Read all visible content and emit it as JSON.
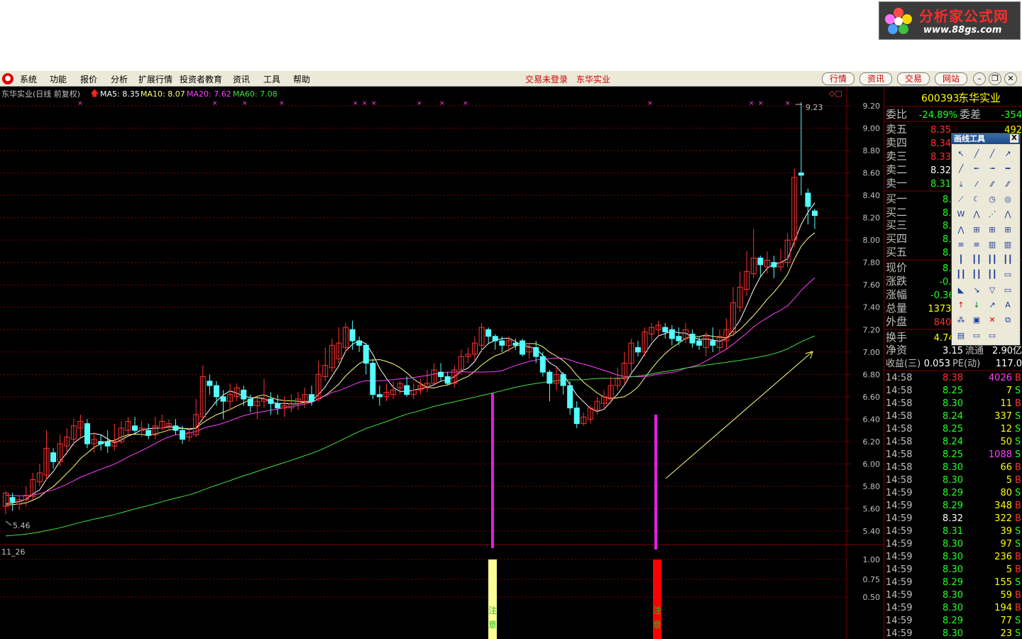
{
  "menu": {
    "items": [
      "系统",
      "功能",
      "报价",
      "分析",
      "扩展行情",
      "投资者教育",
      "资讯",
      "工具",
      "帮助"
    ],
    "center_status": "交易未登录",
    "center_stock": "东华实业",
    "tabs": [
      "行情",
      "资讯",
      "交易",
      "网站"
    ]
  },
  "logo": {
    "title": "分析家公式网",
    "url_text": "www.88gs.com"
  },
  "chart_header": {
    "stock": "东华实业(日线 前复权)",
    "ma5": "MA5: 8.35",
    "ma10": "MA10: 8.07",
    "ma20": "MA20: 7.62",
    "ma60": "MA60: 7.08"
  },
  "colors": {
    "up": "#ff3232",
    "down": "#54ffff",
    "ma5": "#ffffff",
    "ma10": "#ffff80",
    "ma20": "#ff40ff",
    "ma60": "#40e040",
    "grid": "#800000",
    "bg": "#000000"
  },
  "chart_data": {
    "type": "candlestick",
    "price_axis_ticks": [
      "9.20",
      "9.00",
      "8.80",
      "8.60",
      "8.40",
      "8.20",
      "8.00",
      "7.80",
      "7.60",
      "7.40",
      "7.20",
      "7.00",
      "6.80",
      "6.60",
      "6.40",
      "6.20",
      "6.00",
      "5.80",
      "5.60",
      "5.40"
    ],
    "ylim": [
      5.26,
      9.3
    ],
    "high_label": "9.23",
    "low_label": "5.46",
    "indicator_name": "11_26",
    "indicator_ticks": [
      "1.00",
      "0.75",
      "0.50"
    ],
    "signal_text": "注意",
    "candles": [
      [
        5.62,
        5.74,
        5.76,
        5.55
      ],
      [
        5.7,
        5.66,
        5.74,
        5.58
      ],
      [
        5.64,
        5.68,
        5.72,
        5.59
      ],
      [
        5.68,
        5.72,
        5.8,
        5.62
      ],
      [
        5.71,
        5.86,
        5.92,
        5.68
      ],
      [
        5.84,
        5.92,
        6.0,
        5.8
      ],
      [
        5.9,
        6.14,
        6.3,
        5.86
      ],
      [
        6.1,
        6.02,
        6.14,
        5.96
      ],
      [
        6.02,
        6.18,
        6.26,
        5.98
      ],
      [
        6.16,
        6.24,
        6.32,
        6.08
      ],
      [
        6.22,
        6.34,
        6.4,
        6.16
      ],
      [
        6.32,
        6.38,
        6.44,
        6.24
      ],
      [
        6.36,
        6.18,
        6.4,
        6.14
      ],
      [
        6.18,
        6.22,
        6.28,
        6.1
      ],
      [
        6.2,
        6.18,
        6.26,
        6.12
      ],
      [
        6.2,
        6.16,
        6.3,
        6.1
      ],
      [
        6.16,
        6.2,
        6.36,
        6.12
      ],
      [
        6.2,
        6.32,
        6.38,
        6.18
      ],
      [
        6.3,
        6.38,
        6.42,
        6.26
      ],
      [
        6.34,
        6.3,
        6.42,
        6.28
      ],
      [
        6.3,
        6.32,
        6.38,
        6.24
      ],
      [
        6.3,
        6.26,
        6.36,
        6.22
      ],
      [
        6.26,
        6.34,
        6.42,
        6.22
      ],
      [
        6.32,
        6.38,
        6.44,
        6.3
      ],
      [
        6.34,
        6.36,
        6.4,
        6.3
      ],
      [
        6.34,
        6.3,
        6.4,
        6.26
      ],
      [
        6.3,
        6.22,
        6.34,
        6.18
      ],
      [
        6.24,
        6.28,
        6.32,
        6.2
      ],
      [
        6.26,
        6.44,
        6.58,
        6.24
      ],
      [
        6.42,
        6.78,
        6.88,
        6.4
      ],
      [
        6.74,
        6.7,
        6.8,
        6.62
      ],
      [
        6.7,
        6.6,
        6.74,
        6.52
      ],
      [
        6.6,
        6.56,
        6.66,
        6.4
      ],
      [
        6.56,
        6.62,
        6.72,
        6.48
      ],
      [
        6.6,
        6.68,
        6.72,
        6.56
      ],
      [
        6.66,
        6.58,
        6.7,
        6.52
      ],
      [
        6.58,
        6.52,
        6.62,
        6.46
      ],
      [
        6.52,
        6.56,
        6.6,
        6.4
      ],
      [
        6.56,
        6.58,
        6.76,
        6.5
      ],
      [
        6.58,
        6.54,
        6.64,
        6.44
      ],
      [
        6.54,
        6.5,
        6.62,
        6.44
      ],
      [
        6.5,
        6.52,
        6.6,
        6.42
      ],
      [
        6.5,
        6.54,
        6.62,
        6.46
      ],
      [
        6.54,
        6.58,
        6.64,
        6.48
      ],
      [
        6.56,
        6.62,
        6.68,
        6.5
      ],
      [
        6.62,
        6.56,
        6.7,
        6.52
      ],
      [
        6.58,
        6.8,
        6.92,
        6.56
      ],
      [
        6.78,
        6.88,
        7.04,
        6.74
      ],
      [
        6.86,
        7.06,
        7.12,
        6.82
      ],
      [
        6.94,
        7.08,
        7.22,
        6.9
      ],
      [
        7.04,
        7.22,
        7.26,
        7.0
      ],
      [
        7.2,
        7.1,
        7.28,
        7.02
      ],
      [
        7.1,
        7.06,
        7.14,
        7.0
      ],
      [
        7.06,
        6.9,
        7.08,
        6.8
      ],
      [
        6.9,
        6.62,
        6.94,
        6.58
      ],
      [
        6.62,
        6.6,
        6.7,
        6.52
      ],
      [
        6.6,
        6.64,
        6.72,
        6.56
      ],
      [
        6.62,
        6.66,
        6.74,
        6.58
      ],
      [
        6.68,
        6.72,
        6.74,
        6.62
      ],
      [
        6.7,
        6.62,
        6.78,
        6.6
      ],
      [
        6.62,
        6.66,
        6.72,
        6.58
      ],
      [
        6.66,
        6.7,
        6.76,
        6.62
      ],
      [
        6.68,
        6.72,
        6.84,
        6.64
      ],
      [
        6.72,
        6.84,
        6.9,
        6.7
      ],
      [
        6.82,
        6.78,
        6.9,
        6.74
      ],
      [
        6.78,
        6.72,
        6.82,
        6.7
      ],
      [
        6.72,
        6.84,
        6.88,
        6.68
      ],
      [
        6.84,
        6.96,
        7.02,
        6.8
      ],
      [
        6.96,
        6.98,
        7.04,
        6.9
      ],
      [
        6.98,
        7.08,
        7.14,
        6.92
      ],
      [
        7.06,
        7.22,
        7.26,
        7.0
      ],
      [
        7.2,
        7.14,
        7.22,
        7.08
      ],
      [
        7.14,
        7.1,
        7.16,
        7.02
      ],
      [
        7.1,
        7.06,
        7.14,
        7.0
      ],
      [
        7.06,
        7.1,
        7.14,
        7.0
      ],
      [
        7.08,
        7.06,
        7.12,
        7.02
      ],
      [
        7.1,
        6.98,
        7.12,
        6.96
      ],
      [
        7.0,
        7.04,
        7.08,
        6.94
      ],
      [
        7.04,
        6.96,
        7.1,
        6.9
      ],
      [
        6.96,
        6.82,
        7.0,
        6.78
      ],
      [
        6.82,
        6.72,
        6.84,
        6.56
      ],
      [
        6.72,
        6.8,
        6.86,
        6.66
      ],
      [
        6.8,
        6.7,
        6.82,
        6.62
      ],
      [
        6.7,
        6.5,
        6.74,
        6.44
      ],
      [
        6.5,
        6.36,
        6.56,
        6.32
      ],
      [
        6.36,
        6.42,
        6.46,
        6.34
      ],
      [
        6.4,
        6.5,
        6.52,
        6.36
      ],
      [
        6.48,
        6.56,
        6.6,
        6.44
      ],
      [
        6.54,
        6.6,
        6.66,
        6.5
      ],
      [
        6.58,
        6.7,
        6.78,
        6.54
      ],
      [
        6.7,
        6.76,
        6.86,
        6.66
      ],
      [
        6.76,
        6.9,
        7.0,
        6.72
      ],
      [
        6.9,
        7.08,
        7.12,
        6.82
      ],
      [
        7.04,
        7.0,
        7.1,
        6.96
      ],
      [
        7.0,
        7.18,
        7.22,
        6.96
      ],
      [
        7.16,
        7.22,
        7.26,
        7.1
      ],
      [
        7.2,
        7.24,
        7.28,
        7.14
      ],
      [
        7.22,
        7.18,
        7.26,
        7.12
      ],
      [
        7.2,
        7.12,
        7.24,
        7.06
      ],
      [
        7.14,
        7.1,
        7.22,
        7.06
      ],
      [
        7.12,
        7.2,
        7.26,
        7.08
      ],
      [
        7.16,
        7.08,
        7.2,
        7.04
      ],
      [
        7.1,
        7.06,
        7.14,
        7.02
      ],
      [
        7.04,
        7.14,
        7.18,
        6.96
      ],
      [
        7.1,
        7.06,
        7.22,
        7.0
      ],
      [
        7.04,
        7.14,
        7.2,
        7.0
      ],
      [
        7.1,
        7.2,
        7.3,
        7.02
      ],
      [
        7.18,
        7.44,
        7.58,
        7.14
      ],
      [
        7.4,
        7.58,
        7.72,
        7.36
      ],
      [
        7.56,
        7.72,
        7.9,
        7.5
      ],
      [
        7.7,
        7.84,
        8.1,
        7.66
      ],
      [
        7.84,
        7.78,
        7.86,
        7.68
      ],
      [
        7.76,
        7.82,
        7.9,
        7.7
      ],
      [
        7.8,
        7.76,
        7.86,
        7.66
      ],
      [
        7.76,
        7.8,
        7.92,
        7.72
      ],
      [
        7.8,
        8.0,
        8.06,
        7.76
      ],
      [
        8.0,
        8.56,
        8.64,
        7.94
      ],
      [
        8.6,
        8.58,
        9.23,
        8.4
      ],
      [
        8.42,
        8.3,
        8.46,
        8.14
      ],
      [
        8.26,
        8.22,
        8.28,
        8.1
      ]
    ]
  },
  "quote": {
    "code": "600393",
    "name": "东华实业",
    "webi_label": "委比",
    "webi_value": "-24.89%",
    "weicha_label": "委差",
    "weicha_value": "-354",
    "sells": [
      {
        "label": "卖五",
        "price": "8.35",
        "vol": "492"
      },
      {
        "label": "卖四",
        "price": "8.34",
        "vol": ""
      },
      {
        "label": "卖三",
        "price": "8.33",
        "vol": ""
      },
      {
        "label": "卖二",
        "price": "8.32",
        "vol": ""
      },
      {
        "label": "卖一",
        "price": "8.31",
        "vol": ""
      }
    ],
    "buys": [
      {
        "label": "买一",
        "price": "8.30",
        "vol": ""
      },
      {
        "label": "买二",
        "price": "8.29",
        "vol": ""
      },
      {
        "label": "买三",
        "price": "8.28",
        "vol": ""
      },
      {
        "label": "买四",
        "price": "8.27",
        "vol": ""
      },
      {
        "label": "买五",
        "price": "8.26",
        "vol": ""
      }
    ],
    "stats": [
      {
        "label": "现价",
        "value": "8.29"
      },
      {
        "label": "涨跌",
        "value": "-0.03"
      },
      {
        "label": "涨幅",
        "value": "-0.36%"
      },
      {
        "label": "总量",
        "value": "137309"
      },
      {
        "label": "外盘",
        "value": "84088"
      }
    ],
    "huanshou_label": "换手",
    "huanshou_value": "4.74%",
    "jingzi_label": "净资",
    "jingzi_value": "3.15",
    "jingzi_extra": "流通",
    "jingzi_extra_value": "2.90亿",
    "shouyi_label": "收益(三)",
    "shouyi_value": "0.053",
    "pe_label": "PE(动)",
    "pe_value": "117.0"
  },
  "ticks": [
    {
      "time": "14:58",
      "price": "8.38",
      "vol": "4026",
      "side": "B"
    },
    {
      "time": "14:58",
      "price": "8.25",
      "vol": "7",
      "side": "S"
    },
    {
      "time": "14:58",
      "price": "8.30",
      "vol": "11",
      "side": "B"
    },
    {
      "time": "14:58",
      "price": "8.24",
      "vol": "337",
      "side": "S"
    },
    {
      "time": "14:58",
      "price": "8.25",
      "vol": "12",
      "side": "S"
    },
    {
      "time": "14:58",
      "price": "8.24",
      "vol": "50",
      "side": "S"
    },
    {
      "time": "14:58",
      "price": "8.25",
      "vol": "1088",
      "side": "S"
    },
    {
      "time": "14:58",
      "price": "8.30",
      "vol": "66",
      "side": "B"
    },
    {
      "time": "14:58",
      "price": "8.30",
      "vol": "5",
      "side": "B"
    },
    {
      "time": "14:59",
      "price": "8.29",
      "vol": "80",
      "side": "S"
    },
    {
      "time": "14:59",
      "price": "8.29",
      "vol": "348",
      "side": "B"
    },
    {
      "time": "14:59",
      "price": "8.32",
      "vol": "322",
      "side": "B"
    },
    {
      "time": "14:59",
      "price": "8.31",
      "vol": "39",
      "side": "S"
    },
    {
      "time": "14:59",
      "price": "8.30",
      "vol": "97",
      "side": "S"
    },
    {
      "time": "14:59",
      "price": "8.30",
      "vol": "236",
      "side": "B"
    },
    {
      "time": "14:59",
      "price": "8.30",
      "vol": "5",
      "side": "B"
    },
    {
      "time": "14:59",
      "price": "8.29",
      "vol": "155",
      "side": "S"
    },
    {
      "time": "14:59",
      "price": "8.30",
      "vol": "59",
      "side": "B"
    },
    {
      "time": "14:59",
      "price": "8.30",
      "vol": "194",
      "side": "B"
    },
    {
      "time": "14:59",
      "price": "8.29",
      "vol": "77",
      "side": "S"
    },
    {
      "time": "14:59",
      "price": "8.30",
      "vol": "23",
      "side": "S"
    }
  ],
  "draw_tool": {
    "title": "画线工具",
    "close": "X"
  }
}
